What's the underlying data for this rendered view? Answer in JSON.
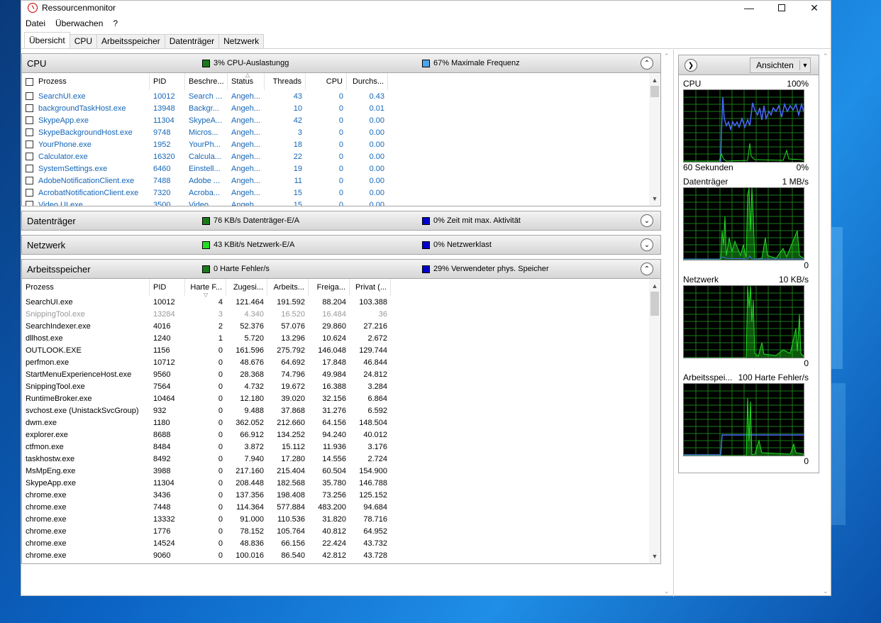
{
  "window": {
    "title": "Ressourcenmonitor"
  },
  "menu": [
    "Datei",
    "Überwachen",
    "?"
  ],
  "tabs": [
    "Übersicht",
    "CPU",
    "Arbeitsspeicher",
    "Datenträger",
    "Netzwerk"
  ],
  "colors": {
    "cpu_swatch": "#1a7a1a",
    "freq_swatch": "#4fa3e8",
    "disk_swatch": "#1a7a1a",
    "net_swatch": "#22dd22",
    "blue_swatch": "#0000cc",
    "mem_swatch": "#1a7a1a"
  },
  "cpu_panel": {
    "title": "CPU",
    "stat1": "3% CPU-Auslastungg",
    "stat2": "67% Maximale Frequenz",
    "columns": [
      "Prozess",
      "PID",
      "Beschre...",
      "Status",
      "Threads",
      "CPU",
      "Durchs..."
    ],
    "rows": [
      [
        "SearchUI.exe",
        "10012",
        "Search ...",
        "Angeh...",
        "43",
        "0",
        "0.43"
      ],
      [
        "backgroundTaskHost.exe",
        "13948",
        "Backgr...",
        "Angeh...",
        "10",
        "0",
        "0.01"
      ],
      [
        "SkypeApp.exe",
        "11304",
        "SkypeA...",
        "Angeh...",
        "42",
        "0",
        "0.00"
      ],
      [
        "SkypeBackgroundHost.exe",
        "9748",
        "Micros...",
        "Angeh...",
        "3",
        "0",
        "0.00"
      ],
      [
        "YourPhone.exe",
        "1952",
        "YourPh...",
        "Angeh...",
        "18",
        "0",
        "0.00"
      ],
      [
        "Calculator.exe",
        "16320",
        "Calcula...",
        "Angeh...",
        "22",
        "0",
        "0.00"
      ],
      [
        "SystemSettings.exe",
        "6460",
        "Einstell...",
        "Angeh...",
        "19",
        "0",
        "0.00"
      ],
      [
        "AdobeNotificationClient.exe",
        "7488",
        "Adobe ...",
        "Angeh...",
        "11",
        "0",
        "0.00"
      ],
      [
        "AcrobatNotificationClient.exe",
        "7320",
        "Acroba...",
        "Angeh...",
        "15",
        "0",
        "0.00"
      ],
      [
        "Video.UI.exe",
        "3500",
        "Video ...",
        "Angeh...",
        "15",
        "0",
        "0.00"
      ]
    ]
  },
  "disk_panel": {
    "title": "Datenträger",
    "stat1": "76 KB/s Datenträger-E/A",
    "stat2": "0% Zeit mit max. Aktivität"
  },
  "net_panel": {
    "title": "Netzwerk",
    "stat1": "43 KBit/s Netzwerk-E/A",
    "stat2": "0% Netzwerklast"
  },
  "mem_panel": {
    "title": "Arbeitsspeicher",
    "stat1": "0 Harte Fehler/s",
    "stat2": "29% Verwendeter phys. Speicher",
    "columns": [
      "Prozess",
      "PID",
      "Harte F...",
      "Zugesi...",
      "Arbeits...",
      "Freiga...",
      "Privat (..."
    ],
    "rows": [
      [
        "SearchUI.exe",
        "10012",
        "4",
        "121.464",
        "191.592",
        "88.204",
        "103.388"
      ],
      [
        "SnippingTool.exe",
        "13284",
        "3",
        "4.340",
        "16.520",
        "16.484",
        "36"
      ],
      [
        "SearchIndexer.exe",
        "4016",
        "2",
        "52.376",
        "57.076",
        "29.860",
        "27.216"
      ],
      [
        "dllhost.exe",
        "1240",
        "1",
        "5.720",
        "13.296",
        "10.624",
        "2.672"
      ],
      [
        "OUTLOOK.EXE",
        "1156",
        "0",
        "161.596",
        "275.792",
        "146.048",
        "129.744"
      ],
      [
        "perfmon.exe",
        "10712",
        "0",
        "48.676",
        "64.692",
        "17.848",
        "46.844"
      ],
      [
        "StartMenuExperienceHost.exe",
        "9560",
        "0",
        "28.368",
        "74.796",
        "49.984",
        "24.812"
      ],
      [
        "SnippingTool.exe",
        "7564",
        "0",
        "4.732",
        "19.672",
        "16.388",
        "3.284"
      ],
      [
        "RuntimeBroker.exe",
        "10464",
        "0",
        "12.180",
        "39.020",
        "32.156",
        "6.864"
      ],
      [
        "svchost.exe (UnistackSvcGroup)",
        "932",
        "0",
        "9.488",
        "37.868",
        "31.276",
        "6.592"
      ],
      [
        "dwm.exe",
        "1180",
        "0",
        "362.052",
        "212.660",
        "64.156",
        "148.504"
      ],
      [
        "explorer.exe",
        "8688",
        "0",
        "66.912",
        "134.252",
        "94.240",
        "40.012"
      ],
      [
        "ctfmon.exe",
        "8484",
        "0",
        "3.872",
        "15.112",
        "11.936",
        "3.176"
      ],
      [
        "taskhostw.exe",
        "8492",
        "0",
        "7.940",
        "17.280",
        "14.556",
        "2.724"
      ],
      [
        "MsMpEng.exe",
        "3988",
        "0",
        "217.160",
        "215.404",
        "60.504",
        "154.900"
      ],
      [
        "SkypeApp.exe",
        "11304",
        "0",
        "208.448",
        "182.568",
        "35.780",
        "146.788"
      ],
      [
        "chrome.exe",
        "3436",
        "0",
        "137.356",
        "198.408",
        "73.256",
        "125.152"
      ],
      [
        "chrome.exe",
        "7448",
        "0",
        "114.364",
        "577.884",
        "483.200",
        "94.684"
      ],
      [
        "chrome.exe",
        "13332",
        "0",
        "91.000",
        "110.536",
        "31.820",
        "78.716"
      ],
      [
        "chrome.exe",
        "1776",
        "0",
        "78.152",
        "105.764",
        "40.812",
        "64.952"
      ],
      [
        "chrome.exe",
        "14524",
        "0",
        "48.836",
        "66.156",
        "22.424",
        "43.732"
      ],
      [
        "chrome.exe",
        "9060",
        "0",
        "100.016",
        "86.540",
        "42.812",
        "43.728"
      ]
    ]
  },
  "side": {
    "views_label": "Ansichten",
    "graphs": [
      {
        "title": "CPU",
        "max": "100%",
        "foot_left": "60 Sekunden",
        "foot_right": "0%"
      },
      {
        "title": "Datenträger",
        "max": "1 MB/s",
        "foot_left": "",
        "foot_right": "0"
      },
      {
        "title": "Netzwerk",
        "max": "10 KB/s",
        "foot_left": "",
        "foot_right": "0"
      },
      {
        "title": "Arbeitsspei...",
        "max": "100 Harte Fehler/s",
        "foot_left": "",
        "foot_right": "0"
      }
    ]
  }
}
